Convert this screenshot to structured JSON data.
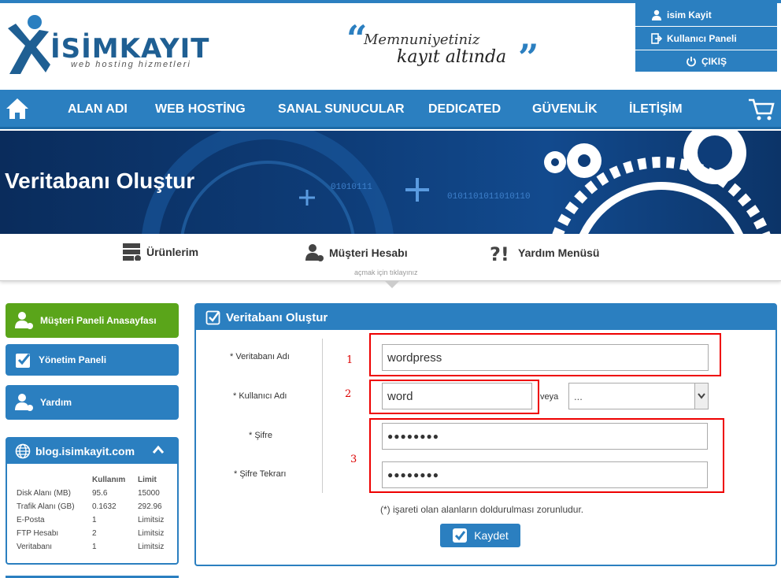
{
  "brand": {
    "name": "İSİMKAYIT",
    "tagline": "web hosting hizmetleri",
    "registered": "®"
  },
  "slogan": {
    "line1": "Memnuniyetiniz",
    "line2": "kayıt altında",
    "quote_open": "“",
    "quote_close": "”"
  },
  "user_menu": {
    "user_name": "isim Kayit",
    "panel_label": "Kullanıcı Paneli",
    "logout_label": "ÇIKIŞ"
  },
  "nav": {
    "items": [
      "ALAN ADI",
      "WEB HOSTİNG",
      "SANAL SUNUCULAR",
      "DEDICATED",
      "GÜVENLİK",
      "İLETİŞİM"
    ]
  },
  "banner": {
    "title": "Veritabanı Oluştur"
  },
  "submenu": {
    "items": [
      "Ürünlerim",
      "Müşteri Hesabı",
      "Yardım Menüsü"
    ],
    "hint": "açmak için tıklayınız"
  },
  "sidebar": {
    "items": [
      "Müşteri Paneli Anasayfası",
      "Yönetim Paneli",
      "Yardım"
    ]
  },
  "blog": {
    "title": "blog.isimkayit.com",
    "headers": [
      "",
      "Kullanım",
      "Limit"
    ],
    "rows": [
      [
        "Disk Alanı (MB)",
        "95.6",
        "15000"
      ],
      [
        "Trafik Alanı (GB)",
        "0.1632",
        "292.96"
      ],
      [
        "E-Posta",
        "1",
        "Limitsiz"
      ],
      [
        "FTP Hesabı",
        "2",
        "Limitsiz"
      ],
      [
        "Veritabanı",
        "1",
        "Limitsiz"
      ]
    ]
  },
  "form": {
    "title": "Veritabanı Oluştur",
    "db_name_label": "* Veritabanı Adı",
    "db_name_value": "wordpress",
    "user_label": "* Kullanıcı Adı",
    "user_value": "word",
    "or_label": "veya",
    "user_select_value": "...",
    "password_label": "* Şifre",
    "password_value": "●●●●●●●●",
    "password_repeat_label": "* Şifre Tekrarı",
    "password_repeat_value": "●●●●●●●●",
    "required_note": "(*) işareti olan alanların doldurulması zorunludur.",
    "save_label": "Kaydet",
    "annotations": [
      "1",
      "2",
      "3"
    ]
  },
  "colors": {
    "primary": "#2b7fc0",
    "green": "#5aa51a",
    "annotation_red": "#e00000"
  }
}
